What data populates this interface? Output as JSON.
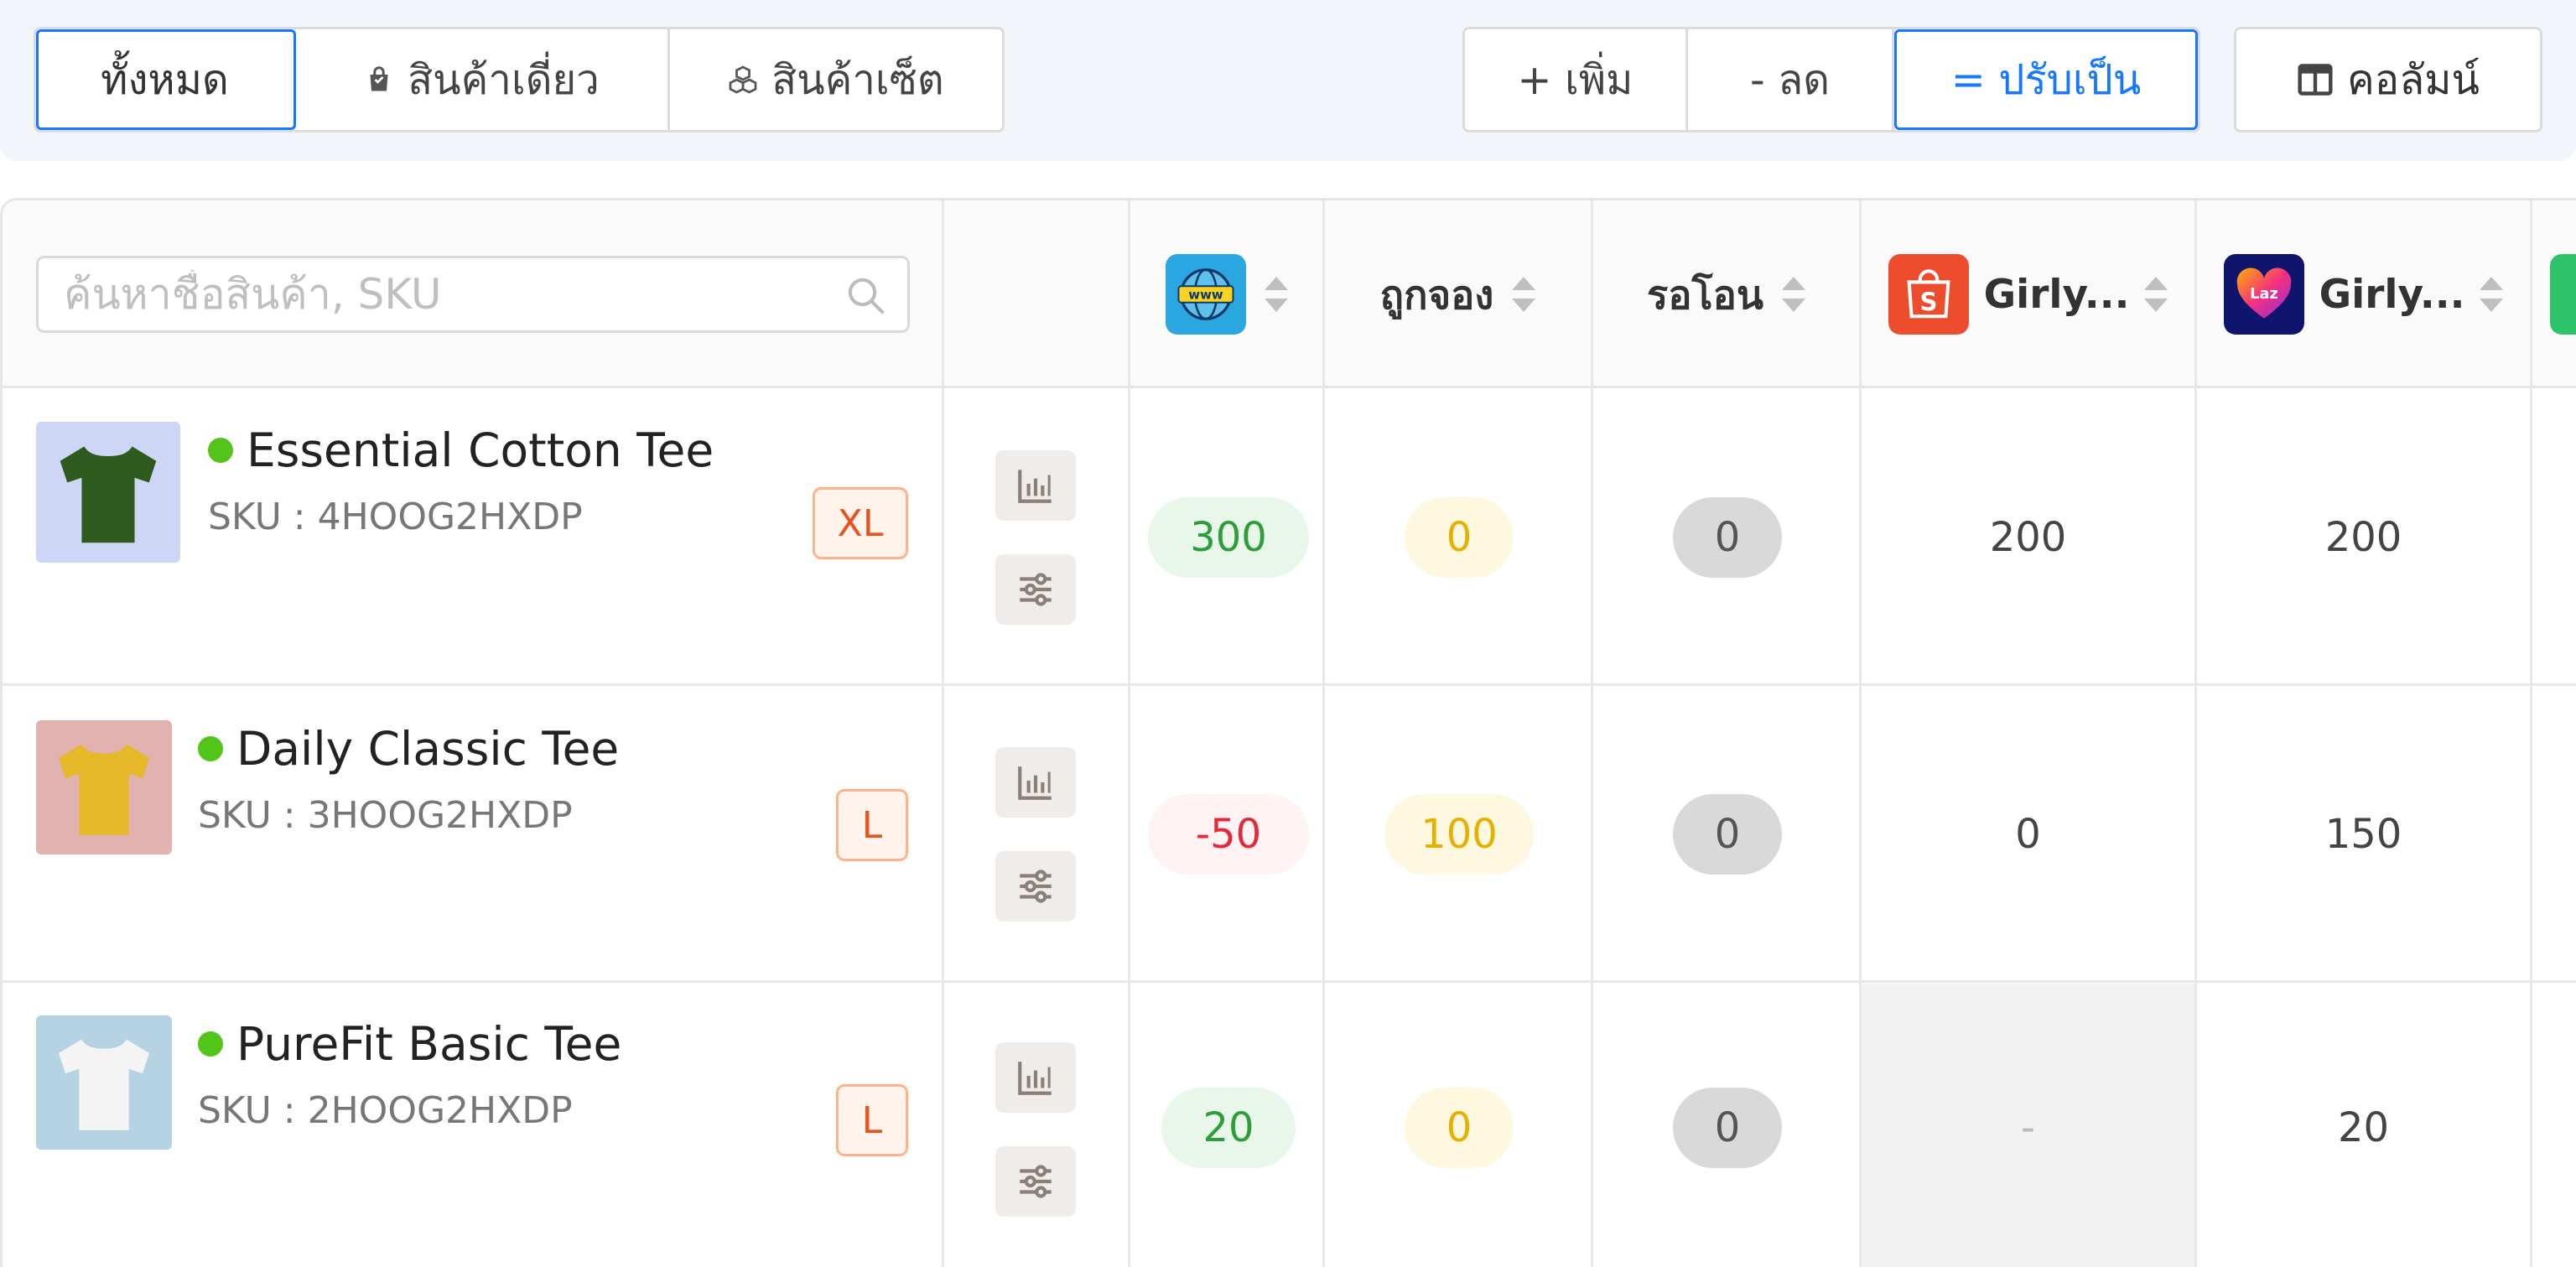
{
  "filter_tabs": {
    "all": "ทั้งหมด",
    "single": "สินค้าเดี่ยว",
    "set": "สินค้าเซ็ต"
  },
  "mode_tabs": {
    "add": "+ เพิ่ม",
    "subtract": "- ลด",
    "set_to": "= ปรับเป็น"
  },
  "columns_button": "คอลัมน์",
  "search": {
    "placeholder": "ค้นหาชื่อสินค้า, SKU"
  },
  "headers": {
    "website_logo_text": "www",
    "reserved": "ถูกจอง",
    "awaiting_transfer": "รอโอน",
    "shopee_logo_text": "S",
    "shopee": "Girly...",
    "lazada_logo_text": "Laz",
    "lazada": "Girly..."
  },
  "products": [
    {
      "name": "Essential Cotton Tee",
      "sku": "SKU : 4HOOG2HXDP",
      "size": "XL",
      "stock": "300",
      "reserved": "0",
      "awaiting": "0",
      "shopee": "200",
      "lazada": "200"
    },
    {
      "name": "Daily Classic Tee",
      "sku": "SKU : 3HOOG2HXDP",
      "size": "L",
      "stock": "-50",
      "reserved": "100",
      "awaiting": "0",
      "shopee": "0",
      "lazada": "150"
    },
    {
      "name": "PureFit Basic Tee",
      "sku": "SKU : 2HOOG2HXDP",
      "size": "L",
      "stock": "20",
      "reserved": "0",
      "awaiting": "0",
      "shopee": "-",
      "lazada": "20"
    }
  ],
  "colors": {
    "accent": "#1677ff",
    "online_dot": "#52c41a",
    "shopee": "#ee4d2d",
    "lazada_bg": "#0f146d",
    "stock_positive": "#2e9e3a",
    "stock_negative": "#e02b3c",
    "reserved": "#e6b000"
  },
  "product_colors": [
    "#2f5a1e",
    "#e5b92a",
    "#f4f4f4"
  ]
}
